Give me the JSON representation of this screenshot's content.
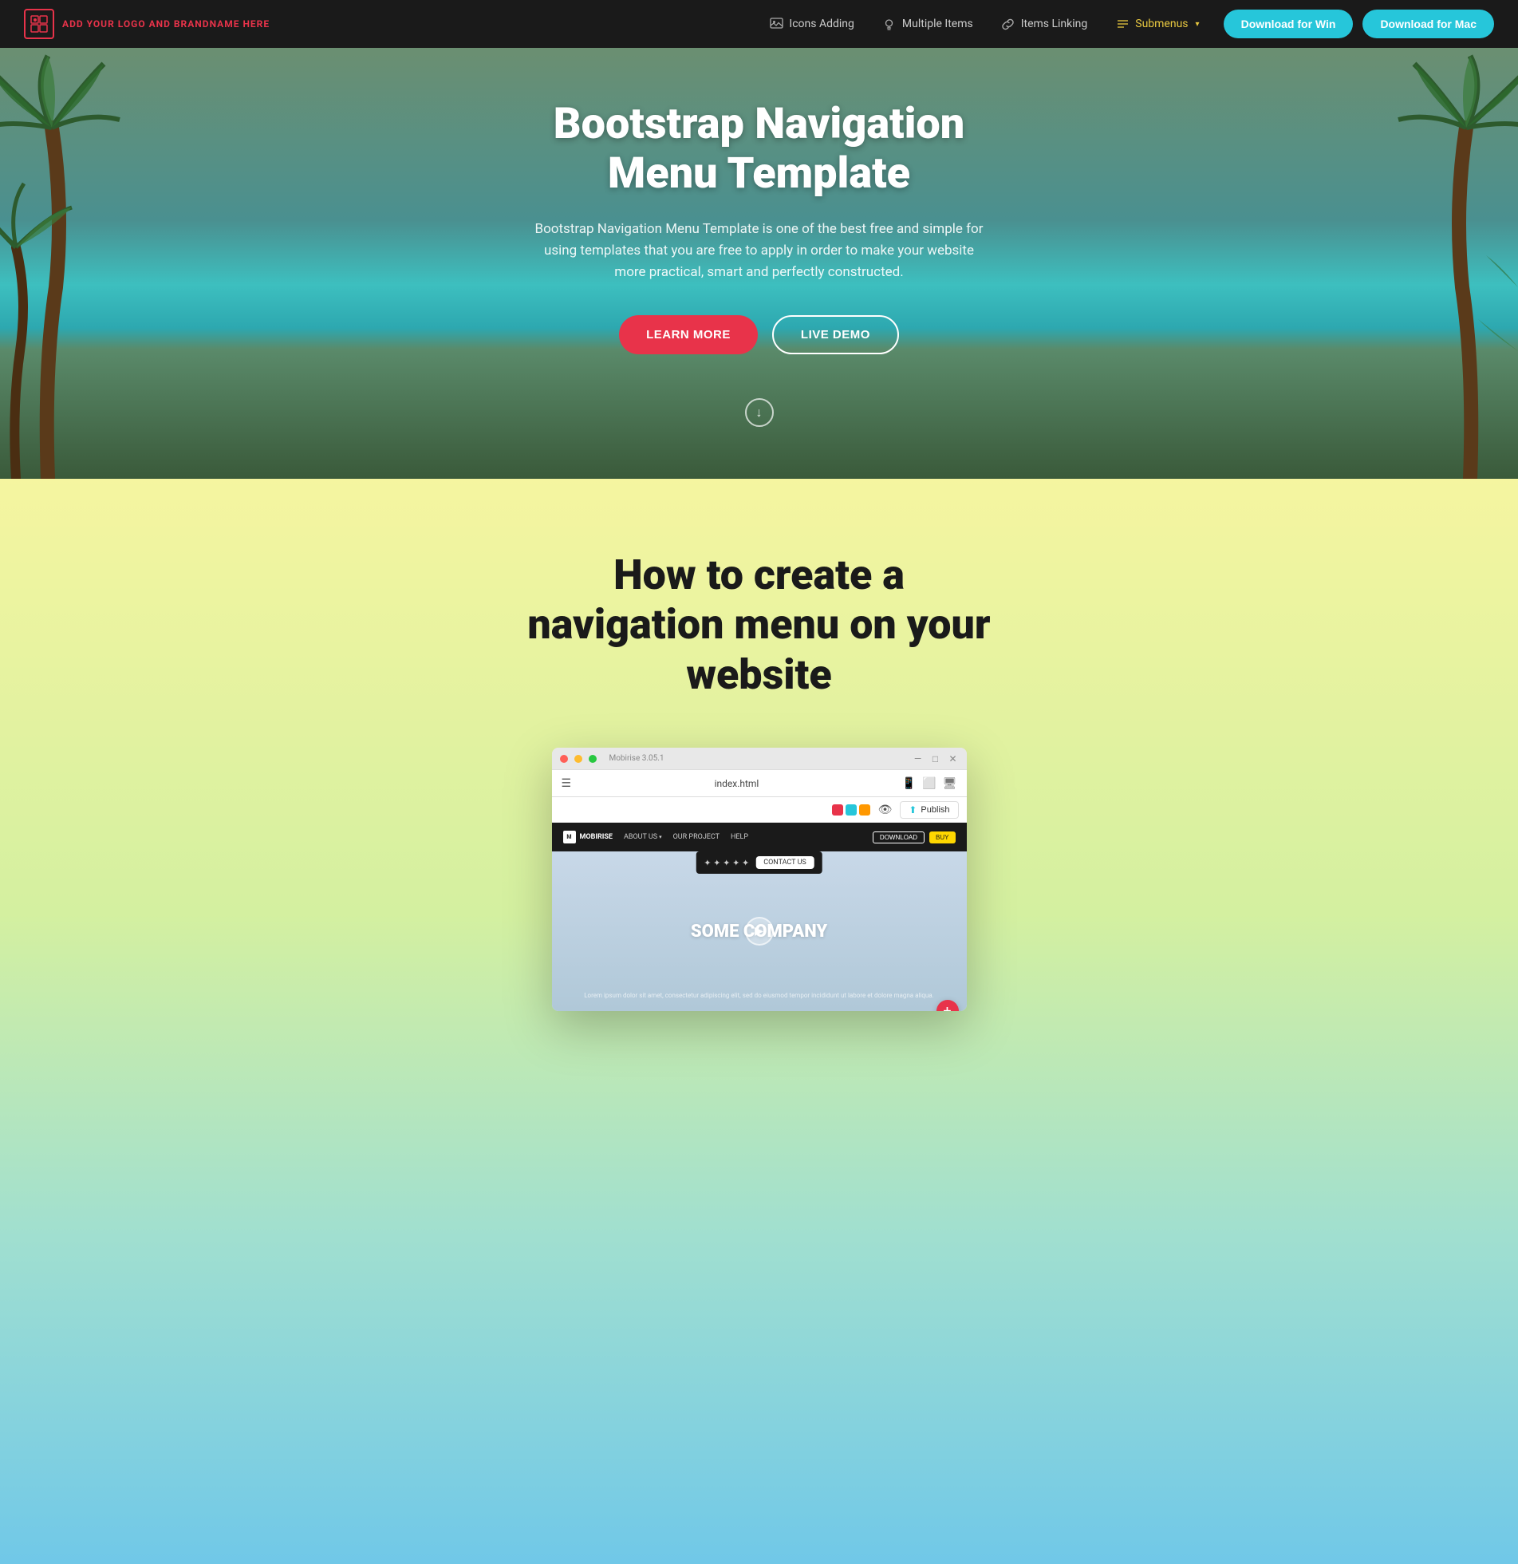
{
  "navbar": {
    "brand_logo_char": "☰",
    "brand_name": "ADD YOUR LOGO AND BRANDNAME HERE",
    "nav_items": [
      {
        "id": "icons-adding",
        "label": "Icons Adding",
        "icon": "🖼",
        "has_chevron": false
      },
      {
        "id": "multiple-items",
        "label": "Multiple Items",
        "icon": "💡",
        "has_chevron": false
      },
      {
        "id": "items-linking",
        "label": "Items Linking",
        "icon": "🔗",
        "has_chevron": false
      },
      {
        "id": "submenus",
        "label": "Submenus",
        "icon": "☰",
        "has_chevron": true
      }
    ],
    "btn_win": "Download for Win",
    "btn_mac": "Download for Mac"
  },
  "hero": {
    "title": "Bootstrap Navigation Menu Template",
    "subtitle": "Bootstrap Navigation Menu Template is one of the best free and simple for using templates that you are free to apply in order to make your website more practical, smart and perfectly constructed.",
    "btn_learn": "LEARN MORE",
    "btn_demo": "LIVE DEMO",
    "scroll_arrow": "↓"
  },
  "section2": {
    "title": "How to create a navigation menu on your website",
    "browser": {
      "title_bar": "Mobirise 3.05.1",
      "address": "index.html",
      "publish_label": "Publish",
      "inner_nav": {
        "logo": "MOBIRISE",
        "links": [
          "ABOUT US",
          "OUR PROJECT",
          "HELP"
        ],
        "btn1": "DOWNLOAD",
        "btn2": "BUY"
      },
      "popup_label": "CONTACT US",
      "inner_hero_title": "SOME COMPANY",
      "inner_hero_text": "Lorem ipsum dolor sit amet, consectetur adipiscing elit, sed do eiusmod tempor incididunt ut labore et dolore magna aliqua.",
      "add_btn": "+"
    }
  },
  "colors": {
    "primary_red": "#e8334a",
    "primary_cyan": "#26c6da",
    "navbar_bg": "#1a1a1a",
    "submenus_color": "#e8c840",
    "hero_bg_gradient_start": "#6b8f71",
    "hero_bg_gradient_end": "#2da8b0",
    "section2_bg_start": "#f5f5a0",
    "section2_bg_end": "#70c8e8"
  }
}
